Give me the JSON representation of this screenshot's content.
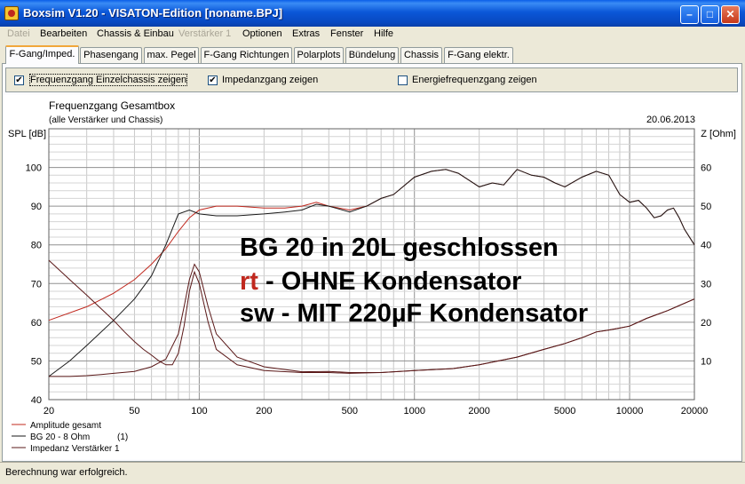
{
  "window": {
    "title": "Boxsim V1.20 - VISATON-Edition [noname.BPJ]"
  },
  "menu": [
    {
      "label": "Datei",
      "disabled": true
    },
    {
      "label": "Bearbeiten",
      "disabled": false
    },
    {
      "label": "Chassis & Einbau",
      "disabled": false
    },
    {
      "label": "Verstärker 1",
      "disabled": true
    },
    {
      "label": "Optionen",
      "disabled": false
    },
    {
      "label": "Extras",
      "disabled": false
    },
    {
      "label": "Fenster",
      "disabled": false
    },
    {
      "label": "Hilfe",
      "disabled": false
    }
  ],
  "tabs": [
    "F-Gang/Imped.",
    "Phasengang",
    "max. Pegel",
    "F-Gang Richtungen",
    "Polarplots",
    "Bündelung",
    "Chassis",
    "F-Gang elektr."
  ],
  "options": [
    {
      "label": "Frequenzgang Einzelchassis zeigen",
      "checked": true
    },
    {
      "label": "Impedanzgang zeigen",
      "checked": true
    },
    {
      "label": "Energiefrequenzgang zeigen",
      "checked": false
    }
  ],
  "chart_data": {
    "type": "line",
    "title": "Frequenzgang Gesamtbox",
    "subtitle": "(alle Verstärker und Chassis)",
    "date": "20.06.2013",
    "ylabel": "SPL [dB]",
    "y2label": "Z [Ohm]",
    "xscale": "log",
    "xlim": [
      20,
      20000
    ],
    "ylim": [
      40,
      110
    ],
    "y2lim": [
      0,
      70
    ],
    "xticks": [
      "20",
      "50",
      "100",
      "200",
      "500",
      "1000",
      "2000",
      "5000",
      "10000",
      "20000"
    ],
    "yticks": [
      "40",
      "50",
      "60",
      "70",
      "80",
      "90",
      "100"
    ],
    "y2ticks": [
      "10",
      "20",
      "30",
      "40",
      "50",
      "60"
    ],
    "grid": true,
    "legend_position": "bottom-left",
    "colors": {
      "red": "#c0281e",
      "black": "#1a1a1a",
      "dark": "#5a1818"
    },
    "annotation": {
      "line1": "BG 20 in 20L geschlossen",
      "line2_highlight": "rt",
      "line2_rest": " - OHNE Kondensator",
      "line3": "sw - MIT 220µF Kondensator"
    },
    "legend": [
      {
        "name": "Amplitude gesamt",
        "suffix": ""
      },
      {
        "name": "BG 20 - 8 Ohm",
        "suffix": "(1)"
      },
      {
        "name": "Impedanz Verstärker 1",
        "suffix": ""
      }
    ],
    "series": [
      {
        "name": "Amplitude gesamt",
        "axis": "left",
        "color": "red",
        "x": [
          20,
          30,
          40,
          50,
          60,
          70,
          80,
          90,
          100,
          120,
          150,
          200,
          250,
          300,
          350,
          400,
          500,
          600,
          700,
          800,
          1000,
          1200,
          1400,
          1600,
          2000,
          2300,
          2600,
          3000,
          3500,
          4000,
          4500,
          5000,
          6000,
          7000,
          8000,
          9000,
          10000,
          11000,
          12000,
          13000,
          14000,
          15000,
          16000,
          17000,
          18000,
          20000
        ],
        "y": [
          60.5,
          64,
          67.5,
          71,
          75,
          79,
          83.5,
          87,
          89,
          90,
          90,
          89.5,
          89.5,
          90,
          91,
          90,
          89,
          90,
          92,
          93,
          97.5,
          99,
          99.5,
          98.5,
          95,
          96,
          95.5,
          99.5,
          98,
          97.5,
          96,
          95,
          97.5,
          99,
          98,
          93,
          91,
          91.5,
          89.5,
          87,
          87.5,
          89,
          89.5,
          87,
          84,
          80
        ]
      },
      {
        "name": "BG 20 - 8 Ohm",
        "axis": "left",
        "color": "black",
        "x": [
          20,
          25,
          30,
          40,
          50,
          60,
          70,
          80,
          90,
          100,
          120,
          150,
          200,
          250,
          300,
          350,
          400,
          500,
          600,
          700,
          800,
          1000,
          1200,
          1400,
          1600,
          2000,
          2300,
          2600,
          3000,
          3500,
          4000,
          4500,
          5000,
          6000,
          7000,
          8000,
          9000,
          10000,
          11000,
          12000,
          13000,
          14000,
          15000,
          16000,
          17000,
          18000,
          20000
        ],
        "y": [
          46,
          50,
          54,
          60.5,
          66,
          72,
          80,
          88,
          89,
          88,
          87.5,
          87.5,
          88,
          88.5,
          89,
          90.5,
          90,
          88.5,
          90,
          92,
          93,
          97.5,
          99,
          99.5,
          98.5,
          95,
          96,
          95.5,
          99.5,
          98,
          97.5,
          96,
          95,
          97.5,
          99,
          98,
          93,
          91,
          91.5,
          89.5,
          87,
          87.5,
          89,
          89.5,
          87,
          84,
          80
        ]
      },
      {
        "name": "Impedanz Verstärker 1 - ohne Kondensator",
        "axis": "right",
        "color": "dark",
        "x": [
          20,
          25,
          30,
          35,
          40,
          50,
          60,
          70,
          80,
          85,
          90,
          95,
          100,
          110,
          120,
          150,
          200,
          300,
          400,
          500,
          700,
          1000,
          1500,
          2000,
          3000,
          4000,
          5000,
          6000,
          7000,
          8000,
          9000,
          10000,
          12000,
          15000,
          20000
        ],
        "y": [
          6,
          6,
          6.2,
          6.5,
          6.8,
          7.3,
          8.5,
          10.5,
          17,
          24,
          31,
          35,
          33,
          24,
          17,
          11,
          8.5,
          7.2,
          7.3,
          7,
          7,
          7.5,
          8,
          9,
          11,
          13,
          14.5,
          16,
          17.5,
          18,
          18.5,
          19,
          21,
          23,
          26
        ]
      },
      {
        "name": "Impedanz Verstärker 1 - mit Kondensator",
        "axis": "right",
        "color": "dark",
        "x": [
          20,
          25,
          30,
          35,
          40,
          45,
          50,
          55,
          60,
          65,
          70,
          75,
          80,
          85,
          90,
          95,
          100,
          110,
          120,
          150,
          200,
          300,
          400,
          500,
          700,
          1000,
          1500,
          2000,
          3000,
          4000,
          5000,
          6000,
          7000,
          8000,
          9000,
          10000,
          12000,
          15000,
          20000
        ],
        "y": [
          36,
          31,
          27,
          23.5,
          20.5,
          17.5,
          15,
          13,
          11.5,
          10,
          9,
          9,
          12,
          19,
          28,
          33,
          30,
          20,
          13,
          9,
          7.5,
          7,
          7,
          6.8,
          7,
          7.5,
          8,
          9,
          11,
          13,
          14.5,
          16,
          17.5,
          18,
          18.5,
          19,
          21,
          23,
          26
        ]
      }
    ]
  },
  "status": {
    "text": "Berechnung war erfolgreich."
  }
}
